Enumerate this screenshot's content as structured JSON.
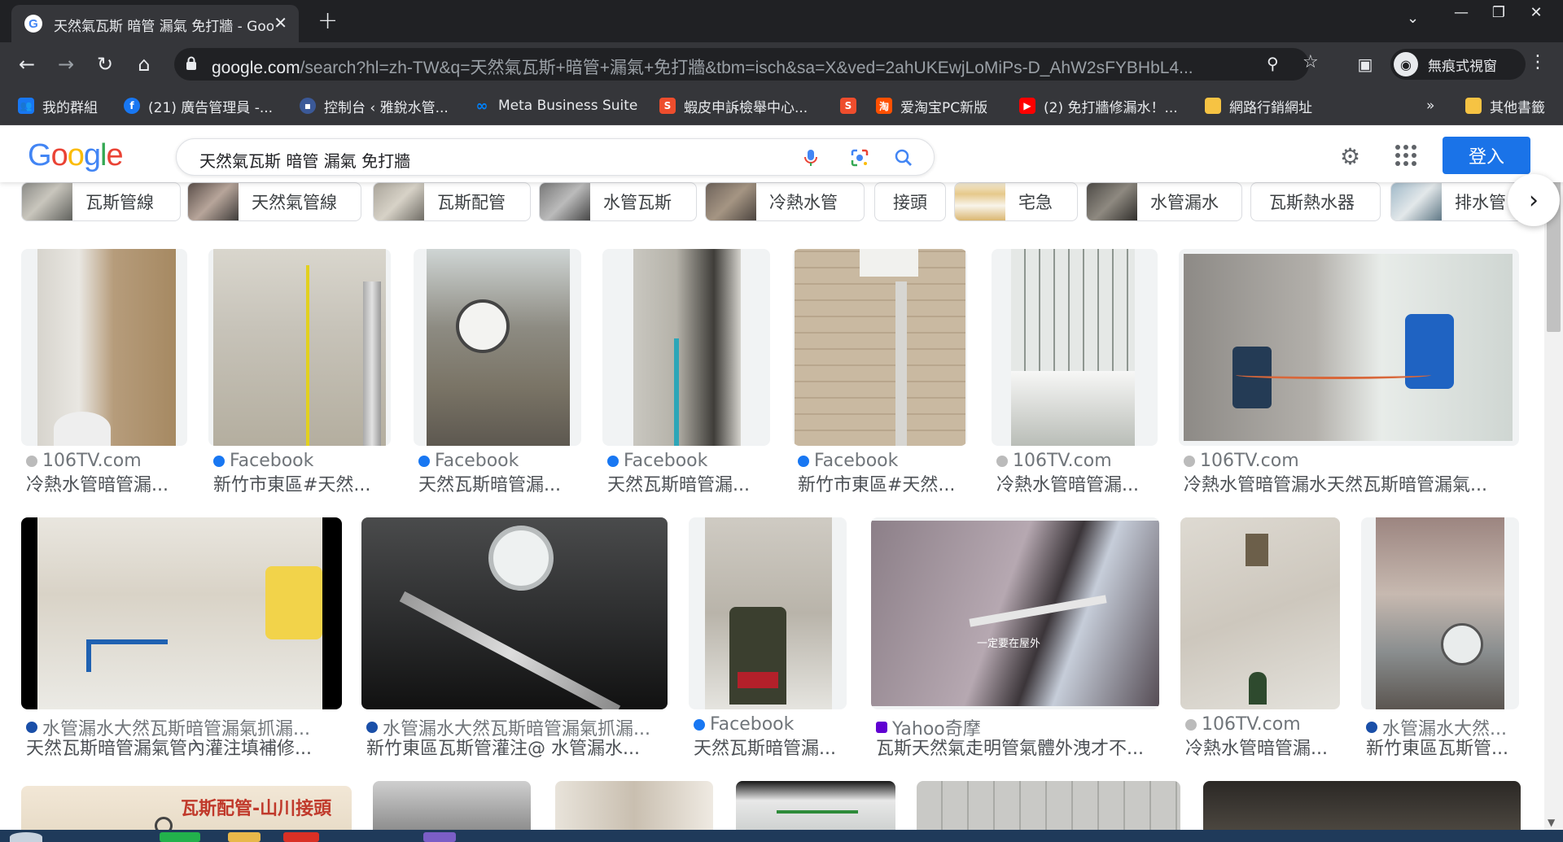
{
  "browser": {
    "tab_title": "天然氣瓦斯 暗管 漏氣 免打牆 - Google 搜尋",
    "url_host": "google.com",
    "url_rest": "/search?hl=zh-TW&q=天然氣瓦斯+暗管+漏氣+免打牆&tbm=isch&sa=X&ved=2ahUKEwjLoMiPs-D_AhW2sFYBHbL4...",
    "profile_label": "無痕式視窗",
    "bookmarks": [
      "我的群組",
      "(21) 廣告管理員 -...",
      "控制台 ‹ 雅銳水管...",
      "Meta Business Suite",
      "蝦皮申訴檢舉中心...",
      "",
      "爱淘宝PC新版",
      "(2) 免打牆修漏水！...",
      "網路行銷網址",
      "其他書籤"
    ],
    "bookmarks_overflow": "»"
  },
  "google": {
    "logo": [
      "G",
      "o",
      "o",
      "g",
      "l",
      "e"
    ],
    "logo_colors": [
      "#4285f4",
      "#ea4335",
      "#fbbc05",
      "#4285f4",
      "#34a853",
      "#ea4335"
    ],
    "query": "天然氣瓦斯 暗管 漏氣 免打牆",
    "signin": "登入"
  },
  "chips": [
    {
      "label": "瓦斯管線"
    },
    {
      "label": "天然氣管線"
    },
    {
      "label": "瓦斯配管"
    },
    {
      "label": "水管瓦斯"
    },
    {
      "label": "冷熱水管"
    },
    {
      "label": "接頭"
    },
    {
      "label": "宅急"
    },
    {
      "label": "水管漏水"
    },
    {
      "label": "瓦斯熱水器"
    },
    {
      "label": "排水管"
    }
  ],
  "results_row1": [
    {
      "source": "106TV.com",
      "title": "冷熱水管暗管漏..."
    },
    {
      "source": "Facebook",
      "title": "新竹市東區#天然..."
    },
    {
      "source": "Facebook",
      "title": "天然瓦斯暗管漏..."
    },
    {
      "source": "Facebook",
      "title": "天然瓦斯暗管漏..."
    },
    {
      "source": "Facebook",
      "title": "新竹市東區#天然..."
    },
    {
      "source": "106TV.com",
      "title": "冷熱水管暗管漏..."
    },
    {
      "source": "106TV.com",
      "title": "冷熱水管暗管漏水天然瓦斯暗管漏氣..."
    }
  ],
  "results_row2": [
    {
      "source": "水管漏水大然瓦斯暗管漏氣抓漏...",
      "title": "天然瓦斯暗管漏氣管內灌注填補修..."
    },
    {
      "source": "水管漏水大然瓦斯暗管漏氣抓漏...",
      "title": "新竹東區瓦斯管灌注@ 水管漏水..."
    },
    {
      "source": "Facebook",
      "title": "天然瓦斯暗管漏..."
    },
    {
      "source": "Yahoo奇摩",
      "title": "瓦斯天然氣走明管氣體外洩才不..."
    },
    {
      "source": "106TV.com",
      "title": "冷熱水管暗管漏..."
    },
    {
      "source": "水管漏水大然...",
      "title": "新竹東區瓦斯管..."
    }
  ],
  "image_text": {
    "row3_banner": "瓦斯配管-山川接頭",
    "row2_overlay": "一定要在屋外"
  }
}
